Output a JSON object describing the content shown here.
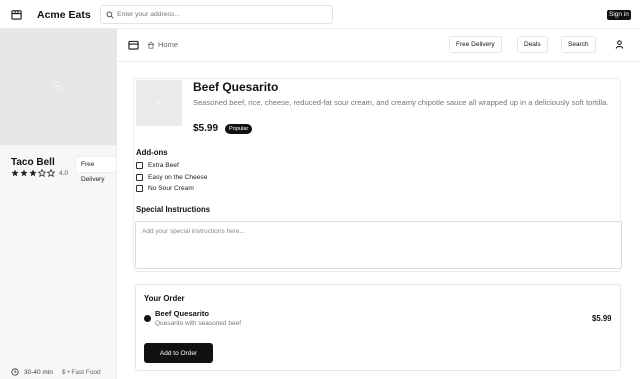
{
  "topbar": {
    "brand": "Acme Eats",
    "brand_icon": "store-icon",
    "search_placeholder": "Enter your address...",
    "search_value": "",
    "sign_in_label": "Sign in"
  },
  "sidebar": {
    "restaurant_name": "Taco Bell",
    "badge": "Free Delivery",
    "rating": 3.0,
    "rating_max": 5,
    "rating_label": "4.0",
    "delivery_time": "30-40 min",
    "meta": "$ • Fast Food"
  },
  "mainbar": {
    "home_label": "Home",
    "buttons": [
      "Free Delivery",
      "Deals",
      "Search"
    ]
  },
  "item": {
    "title": "Beef Quesarito",
    "description": "Seasoned beef, rice, cheese, reduced-fat sour cream, and creamy chipotle sauce all wrapped up in a deliciously soft tortilla.",
    "price": "$5.99",
    "badge": "Popular"
  },
  "addons": {
    "title": "Add-ons",
    "items": [
      {
        "label": "Extra Beef",
        "checked": false
      },
      {
        "label": "Easy on the Cheese",
        "checked": false
      },
      {
        "label": "No Sour Cream",
        "checked": false
      }
    ]
  },
  "special": {
    "title": "Special Instructions",
    "placeholder": "Add your special instructions here..."
  },
  "order": {
    "title": "Your Order",
    "item_name": "Beef Quesarito",
    "item_sub": "Quesarito with seasoned beef",
    "item_price": "$5.99",
    "add_label": "Add to Order"
  },
  "colors": {
    "accent": "#111111",
    "muted_text": "#777777",
    "border": "#e6e6e6",
    "sidebar_bg": "#f7f7f7",
    "image_placeholder": "#e6e6e6"
  }
}
